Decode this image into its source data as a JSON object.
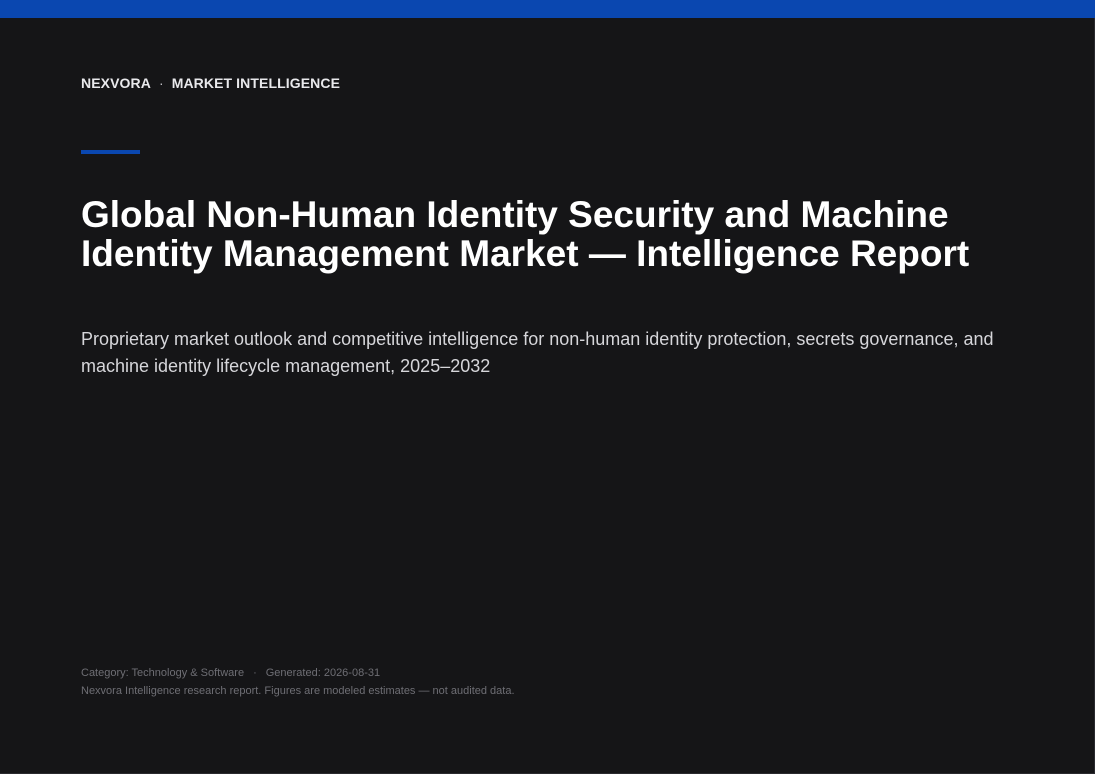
{
  "header": {
    "brand": "NEXVORA",
    "separator": "·",
    "section": "MARKET INTELLIGENCE"
  },
  "report": {
    "title": "Global Non-Human Identity Security and Machine Identity Management Market — Intelligence Report",
    "subtitle": "Proprietary market outlook and competitive intelligence for non-human identity protection, secrets governance, and machine identity lifecycle management, 2025–2032"
  },
  "footer": {
    "category": "Category: Technology & Software",
    "separator": "·",
    "generated": "Generated: 2026-08-31",
    "note": "Nexvora Intelligence research report. Figures are modeled estimates — not audited data."
  },
  "colors": {
    "background": "#151517",
    "accent": "#0a47b0",
    "title": "#ffffff",
    "subtitle": "#d6d6da",
    "muted": "#6e6e74"
  }
}
